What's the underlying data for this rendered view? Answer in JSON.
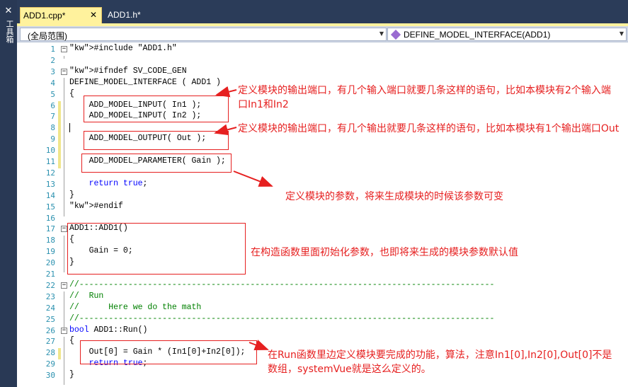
{
  "toolbox": {
    "label": "工具箱"
  },
  "tabs": [
    {
      "label": "ADD1.cpp*",
      "close": "✕"
    },
    {
      "label": "ADD1.h*"
    }
  ],
  "nav": {
    "scope": "(全局范围)",
    "member": "DEFINE_MODEL_INTERFACE(ADD1)"
  },
  "code_lines": [
    {
      "n": "1",
      "text": "#include \"ADD1.h\""
    },
    {
      "n": "2",
      "text": ""
    },
    {
      "n": "3",
      "text": "#ifndef SV_CODE_GEN"
    },
    {
      "n": "4",
      "text": "DEFINE_MODEL_INTERFACE ( ADD1 )"
    },
    {
      "n": "5",
      "text": "{"
    },
    {
      "n": "6",
      "text": "    ADD_MODEL_INPUT( In1 );"
    },
    {
      "n": "7",
      "text": "    ADD_MODEL_INPUT( In2 );"
    },
    {
      "n": "8",
      "text": ""
    },
    {
      "n": "9",
      "text": "    ADD_MODEL_OUTPUT( Out );"
    },
    {
      "n": "10",
      "text": ""
    },
    {
      "n": "11",
      "text": "    ADD_MODEL_PARAMETER( Gain );"
    },
    {
      "n": "12",
      "text": ""
    },
    {
      "n": "13",
      "text": "    return true;"
    },
    {
      "n": "14",
      "text": "}"
    },
    {
      "n": "15",
      "text": "#endif"
    },
    {
      "n": "16",
      "text": ""
    },
    {
      "n": "17",
      "text": "ADD1::ADD1()"
    },
    {
      "n": "18",
      "text": "{"
    },
    {
      "n": "19",
      "text": "    Gain = 0;"
    },
    {
      "n": "20",
      "text": "}"
    },
    {
      "n": "21",
      "text": ""
    },
    {
      "n": "22",
      "text": "//-------------------------------------------------------------------------------------"
    },
    {
      "n": "23",
      "text": "//  Run"
    },
    {
      "n": "24",
      "text": "//      Here we do the math"
    },
    {
      "n": "25",
      "text": "//-------------------------------------------------------------------------------------"
    },
    {
      "n": "26",
      "text": "bool ADD1::Run()"
    },
    {
      "n": "27",
      "text": "{"
    },
    {
      "n": "28",
      "text": "    Out[0] = Gain * (In1[0]+In2[0]);"
    },
    {
      "n": "29",
      "text": "    return true;"
    },
    {
      "n": "30",
      "text": "}"
    }
  ],
  "annotations": {
    "inputs": "定义模块的输出端口，有几个输入端口就要几条这样的语句，比如本模块有2个输入端口In1和In2",
    "outputs": "定义模块的输出端口，有几个输出就要几条这样的语句，比如本模块有1个输出端口Out",
    "parameter": "定义模块的参数，将来生成模块的时候该参数可变",
    "constructor": "在构造函数里面初始化参数，也即将来生成的模块参数默认值",
    "run": "在Run函数里边定义模块要完成的功能，算法，注意In1[0],In2[0],Out[0]不是数组，systemVue就是这么定义的。"
  },
  "colors": {
    "annotation": "#e62020",
    "keyword": "#0000ff",
    "string": "#a31515",
    "comment": "#008000",
    "line_number": "#2b91af",
    "active_tab": "#fff29d",
    "tab_strip": "#2b3c59"
  }
}
